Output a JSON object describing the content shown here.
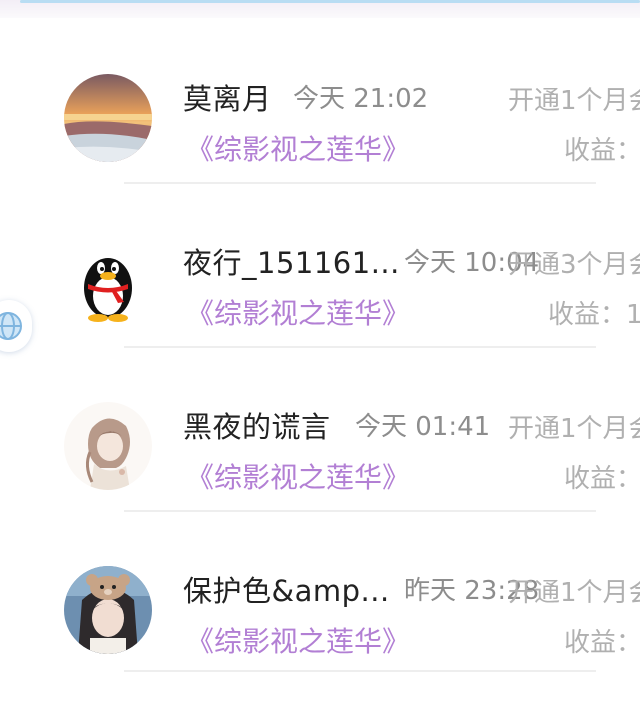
{
  "records": [
    {
      "name": "莫离月",
      "time": "今天 21:02",
      "subscription": "开通1个月会",
      "book": "《综影视之莲华》",
      "income_label": "收益："
    },
    {
      "name": "夜行_151161...",
      "time": "今天 10:04",
      "subscription": "开通3个月会",
      "book": "《综影视之莲华》",
      "income_label": "收益：1"
    },
    {
      "name": "黑夜的谎言",
      "time": "今天 01:41",
      "subscription": "开通1个月会",
      "book": "《综影视之莲华》",
      "income_label": "收益："
    },
    {
      "name": "保护色&amp...",
      "time": "昨天 23:28",
      "subscription": "开通1个月会",
      "book": "《综影视之莲华》",
      "income_label": "收益："
    }
  ],
  "icons": {
    "avatar_1": "sunset-landscape-avatar",
    "avatar_2": "qq-penguin-avatar",
    "avatar_3": "sketch-girl-avatar",
    "avatar_4": "girl-with-bear-ears-avatar",
    "floating_button": "globe-icon"
  },
  "colors": {
    "name": "#222222",
    "time": "#8d8d8d",
    "book": "#b27fd4",
    "muted": "#b0b0b0",
    "divider": "#eeeeee"
  }
}
